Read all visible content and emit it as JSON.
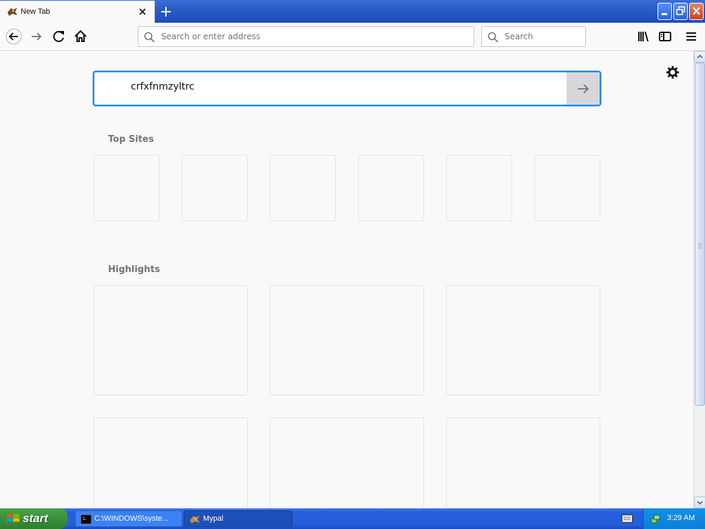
{
  "tab": {
    "title": "New Tab"
  },
  "navbar": {
    "url_placeholder": "Search or enter address",
    "search_placeholder": "Search"
  },
  "content": {
    "search_value": "crfxfnmzyltrc",
    "top_sites_title": "Top Sites",
    "highlights_title": "Highlights"
  },
  "taskbar": {
    "start_label": "start",
    "items": [
      {
        "label": "C:\\WINDOWS\\syste..."
      },
      {
        "label": "Mypal"
      }
    ],
    "clock": "3:29 AM"
  },
  "colors": {
    "accent": "#0a84ff",
    "taskbar_blue": "#245edb",
    "start_green": "#3c943c"
  },
  "icons": [
    "mypal-favicon",
    "close-icon",
    "plus-icon",
    "back-arrow-icon",
    "forward-arrow-icon",
    "reload-icon",
    "home-icon",
    "search-icon",
    "library-icon",
    "sidebar-icon",
    "hamburger-menu-icon",
    "gear-icon",
    "arrow-right-icon",
    "windows-logo-icon",
    "cmd-icon",
    "keyboard-icon",
    "network-icon"
  ]
}
